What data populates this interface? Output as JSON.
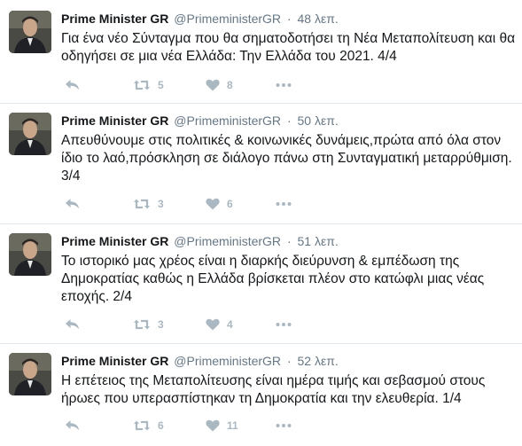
{
  "tweets": [
    {
      "fullname": "Prime Minister GR",
      "username": "@PrimeministerGR",
      "separator": "·",
      "time": "48 λεπ.",
      "text": "Για ένα νέο Σύνταγμα που θα σηματοδοτήσει τη Νέα Μεταπολίτευση και θα οδηγήσει σε μια νέα Ελλάδα: Την Ελλάδα του 2021.  4/4",
      "retweets": "5",
      "likes": "8"
    },
    {
      "fullname": "Prime Minister GR",
      "username": "@PrimeministerGR",
      "separator": "·",
      "time": "50 λεπ.",
      "text": "Απευθύνουμε στις πολιτικές & κοινωνικές δυνάμεις,πρώτα από όλα στον ίδιο το λαό,πρόσκληση σε διάλογο πάνω στη Συνταγματική μεταρρύθμιση. 3/4",
      "retweets": "3",
      "likes": "6"
    },
    {
      "fullname": "Prime Minister GR",
      "username": "@PrimeministerGR",
      "separator": "·",
      "time": "51 λεπ.",
      "text": "Το ιστορικό μας χρέος είναι η διαρκής διεύρυνση & εμπέδωση της Δημοκρατίας καθώς η Ελλάδα βρίσκεται πλέον στο κατώφλι μιας νέας εποχής. 2/4",
      "retweets": "3",
      "likes": "4"
    },
    {
      "fullname": "Prime Minister GR",
      "username": "@PrimeministerGR",
      "separator": "·",
      "time": "52 λεπ.",
      "text": "Η επέτειος της Μεταπολίτευσης είναι ημέρα τιμής και σεβασμού στους ήρωες που υπερασπίστηκαν τη Δημοκρατία και την ελευθερία. 1/4",
      "retweets": "6",
      "likes": "11"
    }
  ],
  "icons": {
    "reply": "reply-icon",
    "retweet": "retweet-icon",
    "like": "heart-icon",
    "more": "more-icon"
  },
  "colors": {
    "text": "#14171a",
    "muted": "#657786",
    "action": "#aab8c2",
    "separator": "#e1e8ed"
  }
}
